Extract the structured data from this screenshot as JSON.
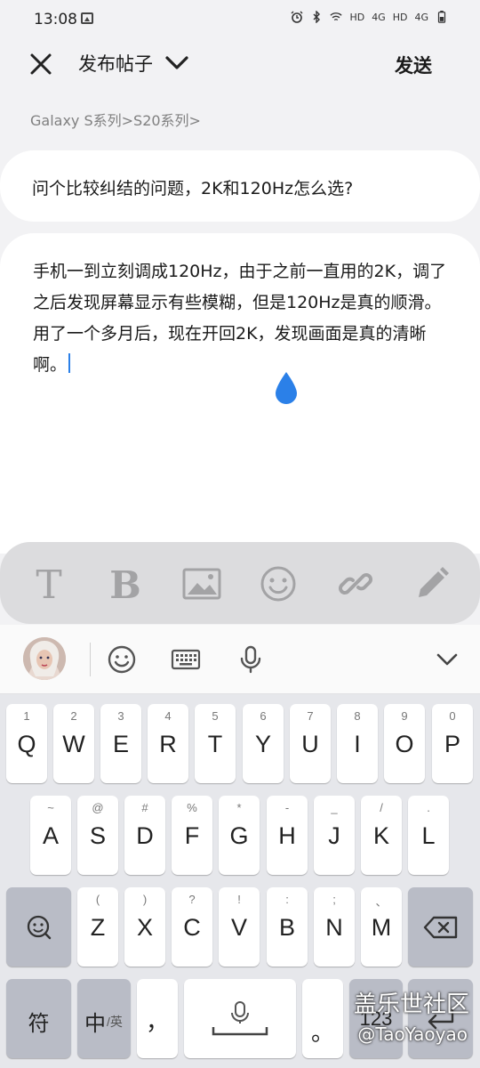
{
  "status_bar": {
    "time": "13:08",
    "icons_right": [
      "alarm-icon",
      "bluetooth-icon",
      "wifi-icon",
      "HD 4G",
      "HD 4G",
      "battery-icon"
    ],
    "hd1": "HD",
    "net1": "4G",
    "hd2": "HD",
    "net2": "4G"
  },
  "header": {
    "title": "发布帖子",
    "send_label": "发送"
  },
  "breadcrumb": "Galaxy S系列>S20系列>",
  "post": {
    "title": "问个比较纠结的问题，2K和120Hz怎么选?",
    "body": "手机一到立刻调成120Hz，由于之前一直用的2K，调了之后发现屏幕显示有些模糊，但是120Hz是真的顺滑。用了一个多月后，现在开回2K，发现画面是真的清晰啊。"
  },
  "format_bar": {
    "t_label": "T",
    "b_label": "B",
    "icons": [
      "text-icon",
      "bold-icon",
      "image-icon",
      "emoji-icon",
      "link-icon",
      "pencil-icon"
    ]
  },
  "keyboard": {
    "row1": [
      {
        "hint": "1",
        "key": "Q"
      },
      {
        "hint": "2",
        "key": "W"
      },
      {
        "hint": "3",
        "key": "E"
      },
      {
        "hint": "4",
        "key": "R"
      },
      {
        "hint": "5",
        "key": "T"
      },
      {
        "hint": "6",
        "key": "Y"
      },
      {
        "hint": "7",
        "key": "U"
      },
      {
        "hint": "8",
        "key": "I"
      },
      {
        "hint": "9",
        "key": "O"
      },
      {
        "hint": "0",
        "key": "P"
      }
    ],
    "row2": [
      {
        "hint": "~",
        "key": "A"
      },
      {
        "hint": "@",
        "key": "S"
      },
      {
        "hint": "#",
        "key": "D"
      },
      {
        "hint": "%",
        "key": "F"
      },
      {
        "hint": "*",
        "key": "G"
      },
      {
        "hint": "-",
        "key": "H"
      },
      {
        "hint": "_",
        "key": "J"
      },
      {
        "hint": "/",
        "key": "K"
      },
      {
        "hint": ".",
        "key": "L"
      }
    ],
    "row3": [
      {
        "hint": "(",
        "key": "Z"
      },
      {
        "hint": ")",
        "key": "X"
      },
      {
        "hint": "?",
        "key": "C"
      },
      {
        "hint": "!",
        "key": "V"
      },
      {
        "hint": ":",
        "key": "B"
      },
      {
        "hint": ";",
        "key": "N"
      },
      {
        "hint": "、",
        "key": "M"
      }
    ],
    "symbol_key": "符",
    "lang_key_main": "中",
    "lang_key_sub": "/英",
    "comma_key": "，",
    "period_key": "。",
    "num_key": "123"
  },
  "watermark": {
    "line1": "盖乐世社区",
    "line2": "@TaoYaoyao"
  },
  "colors": {
    "accent_caret": "#2b80e8",
    "background": "#f2f2f4",
    "format_bar": "#dcdcde"
  }
}
